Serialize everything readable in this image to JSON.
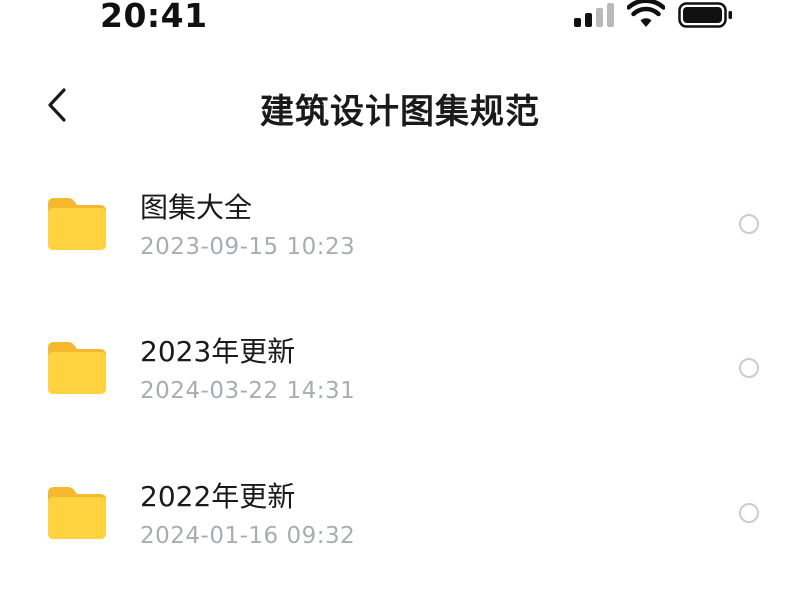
{
  "status_bar": {
    "time": "20:41",
    "signal_icon": "cellular-signal-icon",
    "wifi_icon": "wifi-icon",
    "battery_icon": "battery-icon"
  },
  "header": {
    "back_icon": "chevron-left-icon",
    "title": "建筑设计图集规范"
  },
  "folders": [
    {
      "name": "图集大全",
      "date": "2023-09-15 10:23",
      "icon": "folder-icon"
    },
    {
      "name": "2023年更新",
      "date": "2024-03-22 14:31",
      "icon": "folder-icon"
    },
    {
      "name": "2022年更新",
      "date": "2024-01-16 09:32",
      "icon": "folder-icon"
    }
  ],
  "colors": {
    "folder_front": "#FFD23F",
    "folder_back": "#F5B82E",
    "date_text": "#A9ADB3",
    "radio_border": "#C9CCD0"
  }
}
